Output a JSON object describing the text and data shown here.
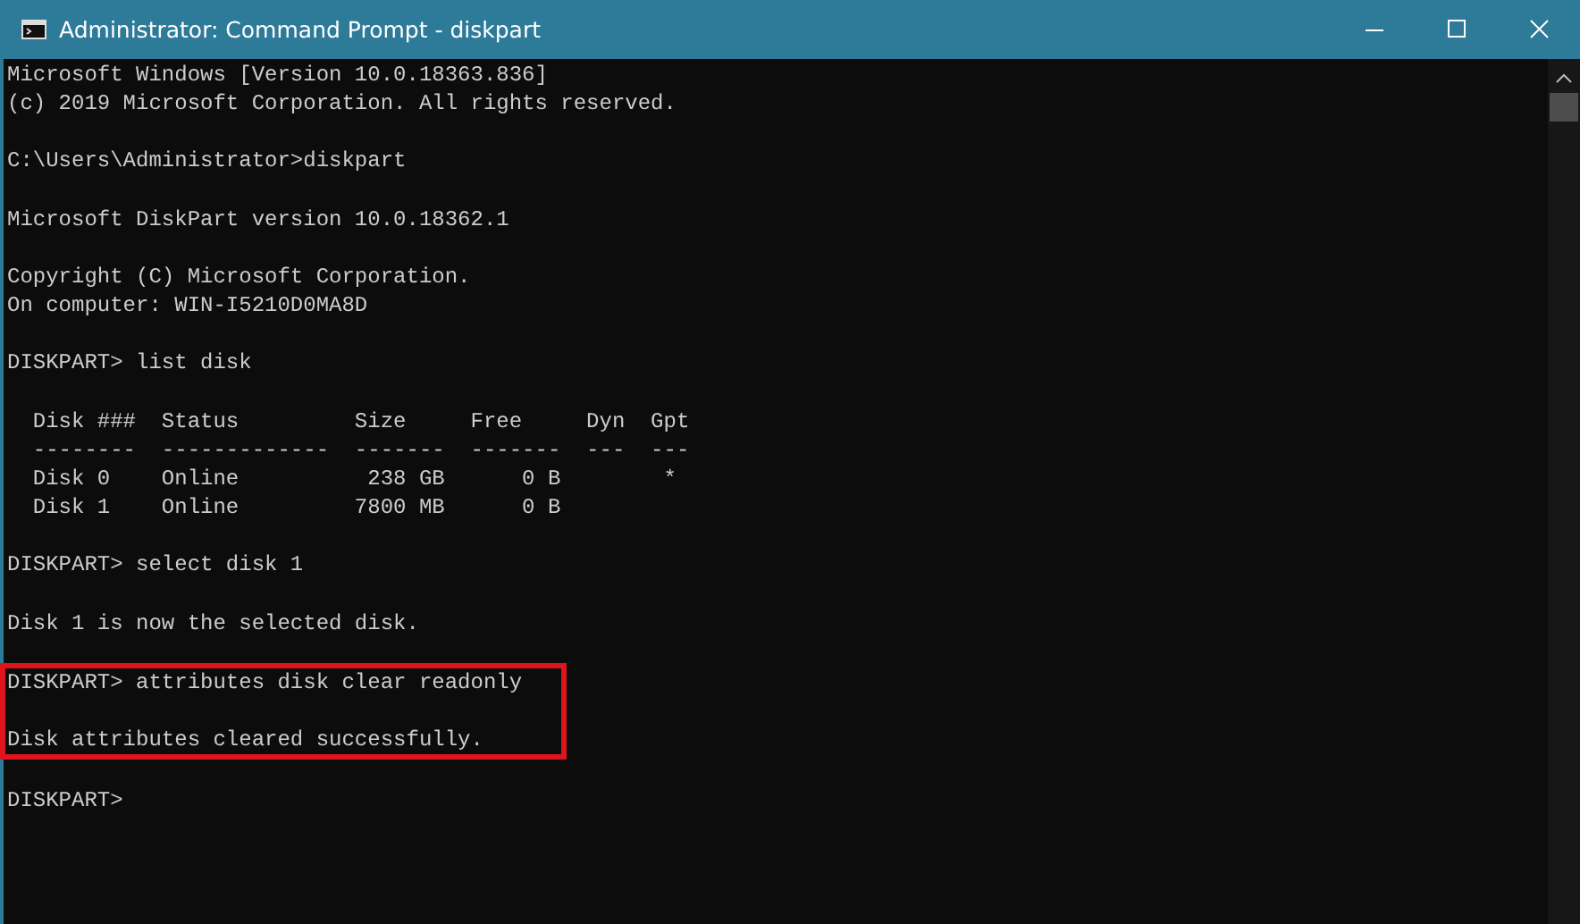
{
  "window": {
    "title": "Administrator: Command Prompt - diskpart"
  },
  "console": {
    "lines": [
      {
        "kind": "text",
        "text": "Microsoft Windows [Version 10.0.18363.836]"
      },
      {
        "kind": "text",
        "text": "(c) 2019 Microsoft Corporation. All rights reserved."
      },
      {
        "kind": "blank"
      },
      {
        "kind": "text",
        "text": "C:\\Users\\Administrator>diskpart"
      },
      {
        "kind": "blank"
      },
      {
        "kind": "text",
        "text": "Microsoft DiskPart version 10.0.18362.1"
      },
      {
        "kind": "blank"
      },
      {
        "kind": "text",
        "text": "Copyright (C) Microsoft Corporation."
      },
      {
        "kind": "text",
        "text": "On computer: WIN-I5210D0MA8D"
      },
      {
        "kind": "blank"
      },
      {
        "kind": "text",
        "text": "DISKPART> list disk"
      },
      {
        "kind": "blank"
      },
      {
        "kind": "text",
        "text": "  Disk ###  Status         Size     Free     Dyn  Gpt"
      },
      {
        "kind": "text",
        "text": "  --------  -------------  -------  -------  ---  ---"
      },
      {
        "kind": "text",
        "text": "  Disk 0    Online          238 GB      0 B        *"
      },
      {
        "kind": "text",
        "text": "  Disk 1    Online         7800 MB      0 B"
      },
      {
        "kind": "blank"
      },
      {
        "kind": "text",
        "text": "DISKPART> select disk 1"
      },
      {
        "kind": "blank"
      },
      {
        "kind": "text",
        "text": "Disk 1 is now the selected disk."
      },
      {
        "kind": "blank"
      },
      {
        "kind": "highlight",
        "lines": [
          {
            "kind": "text",
            "text": "DISKPART> attributes disk clear readonly"
          },
          {
            "kind": "blank"
          },
          {
            "kind": "text",
            "text": "Disk attributes cleared successfully."
          }
        ]
      },
      {
        "kind": "blank"
      },
      {
        "kind": "text",
        "text": "DISKPART>"
      }
    ]
  }
}
